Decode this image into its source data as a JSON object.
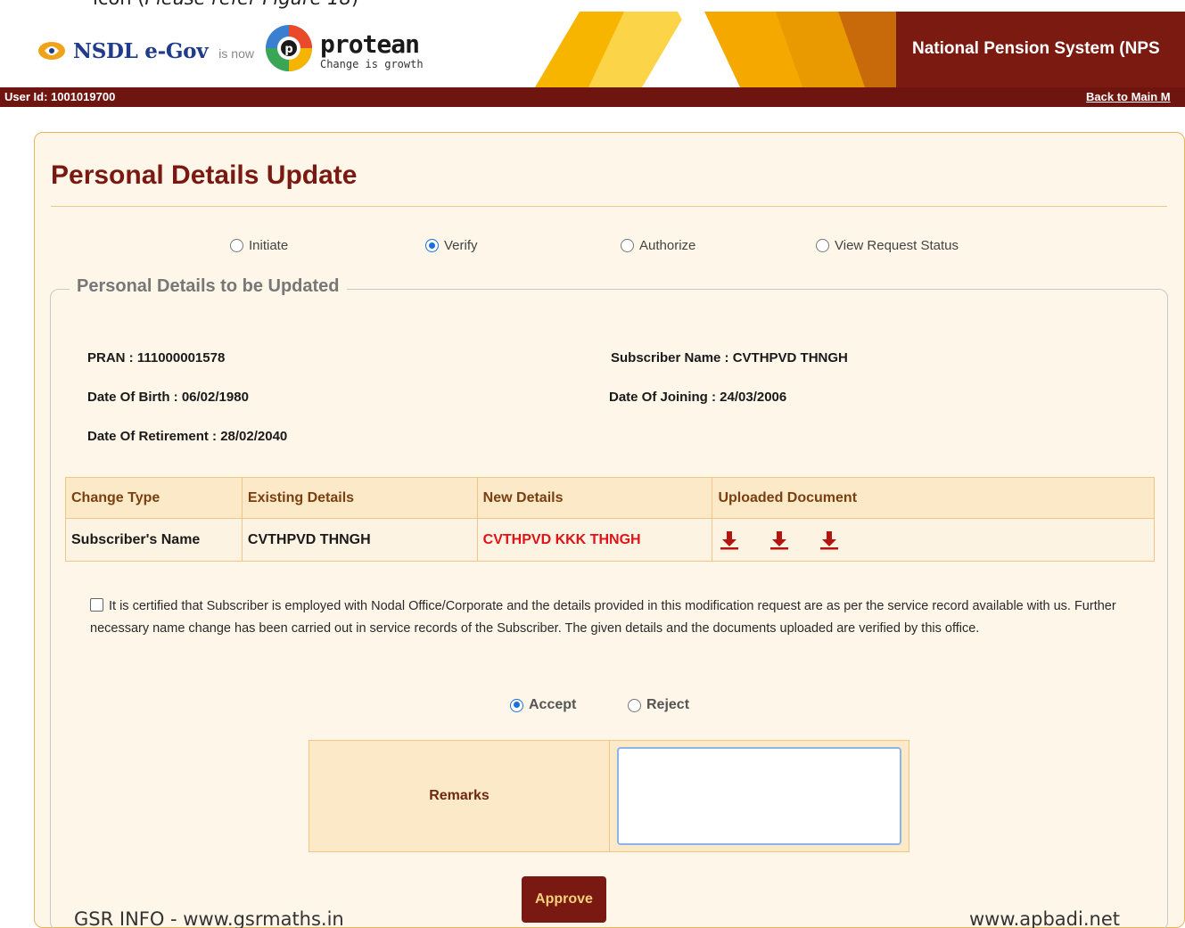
{
  "doc_caption": {
    "text": "icon (",
    "italic": "Please refer Figure 18",
    "end": ")"
  },
  "header": {
    "brand_nsdl": "NSDL e-Gov",
    "is_now": "is now",
    "brand_protean": "protean",
    "tagline": "Change is growth",
    "title": "National Pension System (NPS",
    "colors": {
      "maroon": "#7a1a10",
      "gold": "#f5b800"
    }
  },
  "userbar": {
    "user_id": "User Id: 1001019700",
    "back_link": "Back to Main M"
  },
  "page": {
    "title": "Personal Details Update",
    "mode_options": [
      {
        "label": "Initiate",
        "checked": false
      },
      {
        "label": "Verify",
        "checked": true
      },
      {
        "label": "Authorize",
        "checked": false
      },
      {
        "label": "View Request Status",
        "checked": false
      }
    ],
    "section_legend": "Personal Details to be Updated",
    "info": {
      "pran": "PRAN : 111000001578",
      "subscriber_name": "Subscriber Name : CVTHPVD THNGH",
      "dob": "Date Of Birth : 06/02/1980",
      "doj": "Date Of Joining : 24/03/2006",
      "dor": "Date Of Retirement : 28/02/2040"
    },
    "table": {
      "headers": [
        "Change Type",
        "Existing Details",
        "New Details",
        "Uploaded Document"
      ],
      "rows": [
        {
          "change_type": "Subscriber's Name",
          "existing": "CVTHPVD THNGH",
          "new": "CVTHPVD KKK THNGH",
          "documents": [
            "download-icon",
            "download-icon",
            "download-icon"
          ]
        }
      ]
    },
    "certification": "It is certified that Subscriber is employed with Nodal Office/Corporate and the details provided in this modification request are as per the service record available with us. Further necessary name change has been carried out in service records of the Subscriber. The given details and the documents uploaded are verified by this office.",
    "decision": [
      {
        "label": "Accept",
        "checked": true
      },
      {
        "label": "Reject",
        "checked": false
      }
    ],
    "remarks_label": "Remarks",
    "remarks_value": "",
    "approve_label": "Approve"
  },
  "watermarks": {
    "left": "GSR INFO - www.gsrmaths.in",
    "right": "www.apbadi.net"
  }
}
